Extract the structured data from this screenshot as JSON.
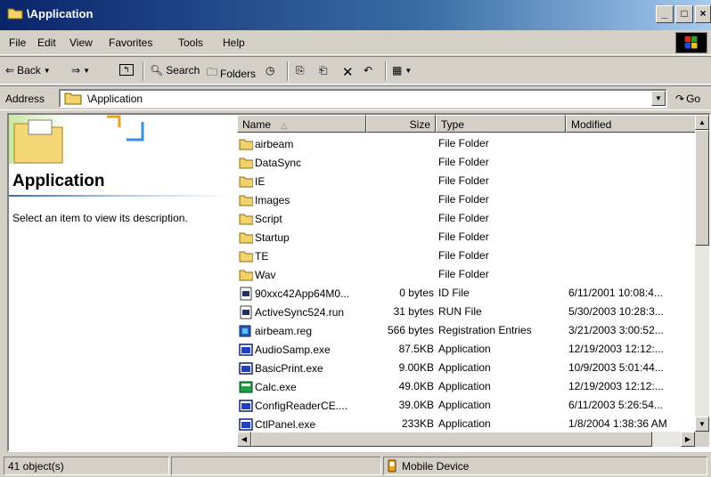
{
  "window": {
    "title": "\\Application"
  },
  "menu": [
    "File",
    "Edit",
    "View",
    "Favorites",
    "Tools",
    "Help"
  ],
  "toolbar": {
    "back": "Back",
    "search": "Search",
    "folders": "Folders"
  },
  "address": {
    "label": "Address",
    "value": "\\Application",
    "go": "Go"
  },
  "left_pane": {
    "title": "Application",
    "description": "Select an item to view its description."
  },
  "columns": {
    "name": "Name",
    "size": "Size",
    "type": "Type",
    "modified": "Modified"
  },
  "files": [
    {
      "name": "airbeam",
      "size": "",
      "type": "File Folder",
      "modified": "",
      "icon": "folder-icon"
    },
    {
      "name": "DataSync",
      "size": "",
      "type": "File Folder",
      "modified": "",
      "icon": "folder-icon"
    },
    {
      "name": "IE",
      "size": "",
      "type": "File Folder",
      "modified": "",
      "icon": "folder-icon"
    },
    {
      "name": "Images",
      "size": "",
      "type": "File Folder",
      "modified": "",
      "icon": "folder-icon"
    },
    {
      "name": "Script",
      "size": "",
      "type": "File Folder",
      "modified": "",
      "icon": "folder-icon"
    },
    {
      "name": "Startup",
      "size": "",
      "type": "File Folder",
      "modified": "",
      "icon": "folder-icon"
    },
    {
      "name": "TE",
      "size": "",
      "type": "File Folder",
      "modified": "",
      "icon": "folder-icon"
    },
    {
      "name": "Wav",
      "size": "",
      "type": "File Folder",
      "modified": "",
      "icon": "folder-icon"
    },
    {
      "name": "90xxc42App64M0...",
      "size": "0 bytes",
      "type": "ID File",
      "modified": "6/11/2001 10:08:4...",
      "icon": "generic-file-icon"
    },
    {
      "name": "ActiveSync524.run",
      "size": "31 bytes",
      "type": "RUN File",
      "modified": "5/30/2003 10:28:3...",
      "icon": "generic-file-icon"
    },
    {
      "name": "airbeam.reg",
      "size": "566 bytes",
      "type": "Registration Entries",
      "modified": "3/21/2003 3:00:52...",
      "icon": "registry-file-icon"
    },
    {
      "name": "AudioSamp.exe",
      "size": "87.5KB",
      "type": "Application",
      "modified": "12/19/2003 12:12:...",
      "icon": "application-icon"
    },
    {
      "name": "BasicPrint.exe",
      "size": "9.00KB",
      "type": "Application",
      "modified": "10/9/2003 5:01:44...",
      "icon": "application-icon"
    },
    {
      "name": "Calc.exe",
      "size": "49.0KB",
      "type": "Application",
      "modified": "12/19/2003 12:12:...",
      "icon": "calculator-icon"
    },
    {
      "name": "ConfigReaderCE....",
      "size": "39.0KB",
      "type": "Application",
      "modified": "6/11/2003 5:26:54...",
      "icon": "application-icon"
    },
    {
      "name": "CtlPanel.exe",
      "size": "233KB",
      "type": "Application",
      "modified": "1/8/2004 1:38:36 AM",
      "icon": "application-icon"
    }
  ],
  "status": {
    "count": "41 object(s)",
    "location": "Mobile Device"
  }
}
